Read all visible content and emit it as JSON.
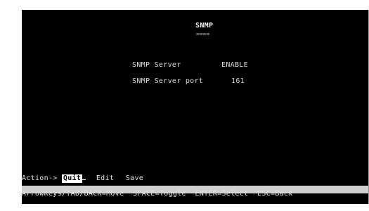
{
  "screen": {
    "title": "SNMP",
    "title_underline": "====",
    "fields": [
      {
        "label": "SNMP Server",
        "value": "ENABLE"
      },
      {
        "label": "SNMP Server port",
        "value": "161"
      }
    ]
  },
  "action_bar": {
    "prompt": "Action->",
    "items": [
      {
        "label": "Quit",
        "selected": true
      },
      {
        "label": "Edit",
        "selected": false
      },
      {
        "label": "Save",
        "selected": false
      }
    ]
  },
  "hint_bar": {
    "text": "ArrowKeys/TAB/BACK=Move  SPACE=Toggle  ENTER=Select  ESC=Back"
  }
}
